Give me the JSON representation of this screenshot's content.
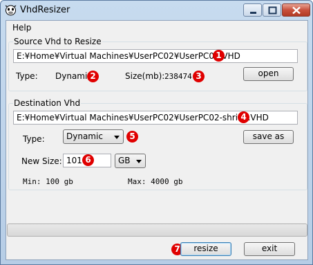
{
  "window": {
    "title": "VhdResizer"
  },
  "menu": {
    "help": "Help"
  },
  "source": {
    "group_label": "Source Vhd to Resize",
    "path": "E:¥Home¥Virtual Machines¥UserPC02¥UserPC02.VHD",
    "type_label": "Type:",
    "type_value": "Dynamic",
    "size_label": "Size(mb):",
    "size_value": "238474",
    "open_label": "open"
  },
  "destination": {
    "group_label": "Destination Vhd",
    "path": "E:¥Home¥Virtual Machines¥UserPC02¥UserPC02-shrink.VHD",
    "type_label": "Type:",
    "type_selected": "Dynamic",
    "save_as_label": "save as",
    "new_size_label": "New Size:",
    "new_size_value": "101",
    "unit_selected": "GB",
    "min_text": "Min: 100 gb",
    "max_text": "Max: 4000 gb"
  },
  "progress": {
    "value": 0
  },
  "actions": {
    "resize_label": "resize",
    "exit_label": "exit"
  },
  "markers": [
    "1",
    "2",
    "3",
    "4",
    "5",
    "6",
    "7"
  ],
  "colors": {
    "marker": "#e00000",
    "titlebar": "#c7dbef",
    "close_button": "#c8513d"
  },
  "icons": {
    "app": "cow-face-icon",
    "minimize": "minimize-icon",
    "maximize": "maximize-icon",
    "close": "close-icon"
  }
}
